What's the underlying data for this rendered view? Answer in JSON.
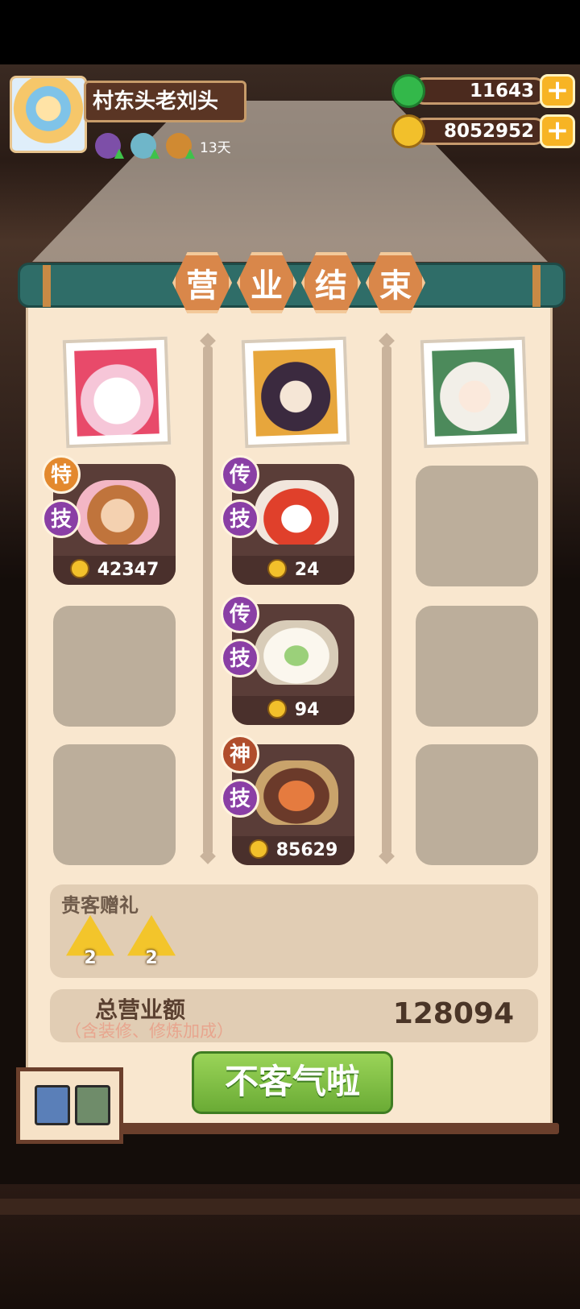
{
  "player": {
    "name": "村东头老刘头",
    "days": "13天"
  },
  "currency": {
    "jade": "11643",
    "coins": "8052952"
  },
  "title_chars": [
    "营",
    "业",
    "结",
    "束"
  ],
  "columns": [
    {
      "dishes": [
        {
          "badges": [
            "特",
            "技"
          ],
          "price": "42347"
        }
      ]
    },
    {
      "dishes": [
        {
          "badges": [
            "传",
            "技"
          ],
          "price": "24"
        },
        {
          "badges": [
            "传",
            "技"
          ],
          "price": "94"
        },
        {
          "badges": [
            "神",
            "技"
          ],
          "price": "85629"
        }
      ]
    },
    {
      "dishes": []
    }
  ],
  "gift": {
    "label": "贵客赠礼",
    "items": [
      {
        "count": "2"
      },
      {
        "count": "2"
      }
    ]
  },
  "total": {
    "label": "总营业额",
    "note": "（含装修、修炼加成）",
    "value": "128094"
  },
  "confirm_button": "不客气啦",
  "colors": {
    "banner": "#2f6d68",
    "panel": "#f9e7cf",
    "button": "#7cbf3f",
    "badge_orange": "#e3892e",
    "badge_purple": "#8a3fa5"
  }
}
